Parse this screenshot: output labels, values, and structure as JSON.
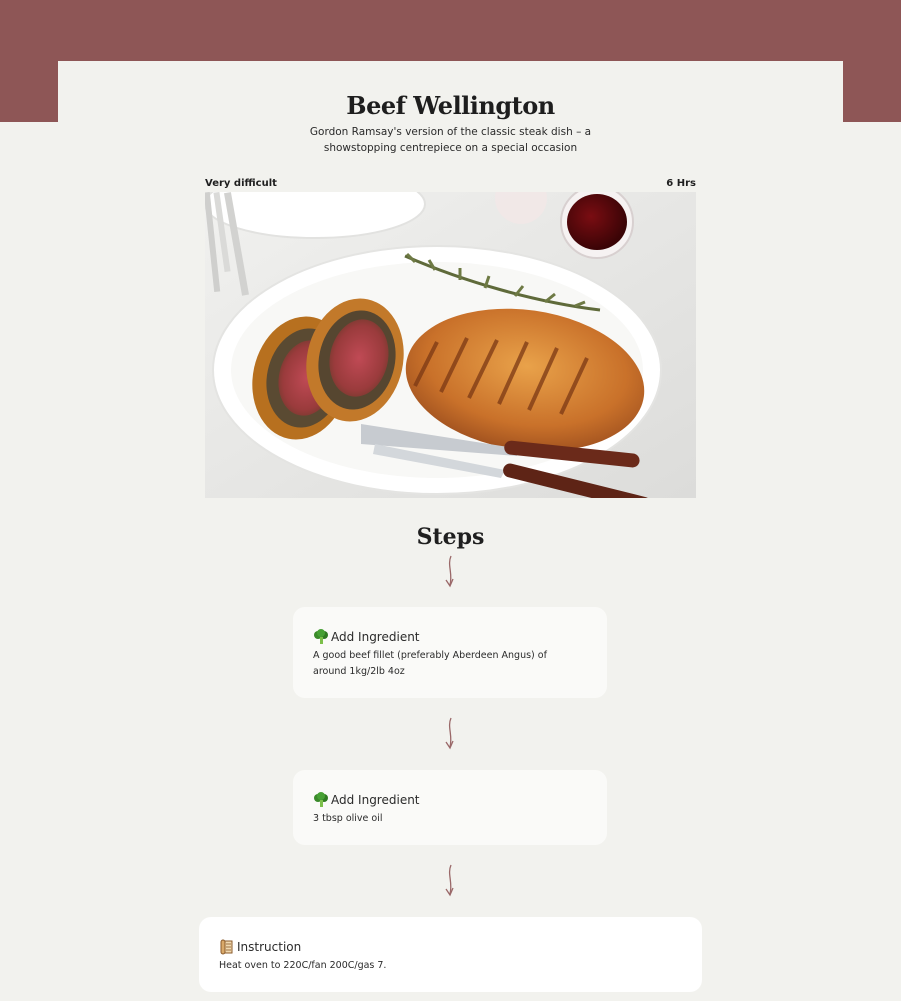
{
  "recipe": {
    "title": "Beef Wellington",
    "subtitle": "Gordon Ramsay's version of the classic steak dish – a showstopping centrepiece on a special occasion",
    "difficulty": "Very difficult",
    "time": "6 Hrs"
  },
  "steps_section": {
    "title": "Steps",
    "items": [
      {
        "type_label": "Add Ingredient",
        "icon": "broccoli-icon",
        "text": "A good beef fillet (preferably Aberdeen Angus) of around 1kg/2lb 4oz"
      },
      {
        "type_label": "Add Ingredient",
        "icon": "broccoli-icon",
        "text": "3 tbsp olive oil"
      },
      {
        "type_label": "Instruction",
        "icon": "scroll-icon",
        "text": "Heat oven to 220C/fan 200C/gas 7."
      }
    ]
  },
  "colors": {
    "header_band": "#8e5656",
    "page_background": "#f2f2ee",
    "arrow": "#9a6868",
    "card_background": "#fafaf8"
  }
}
